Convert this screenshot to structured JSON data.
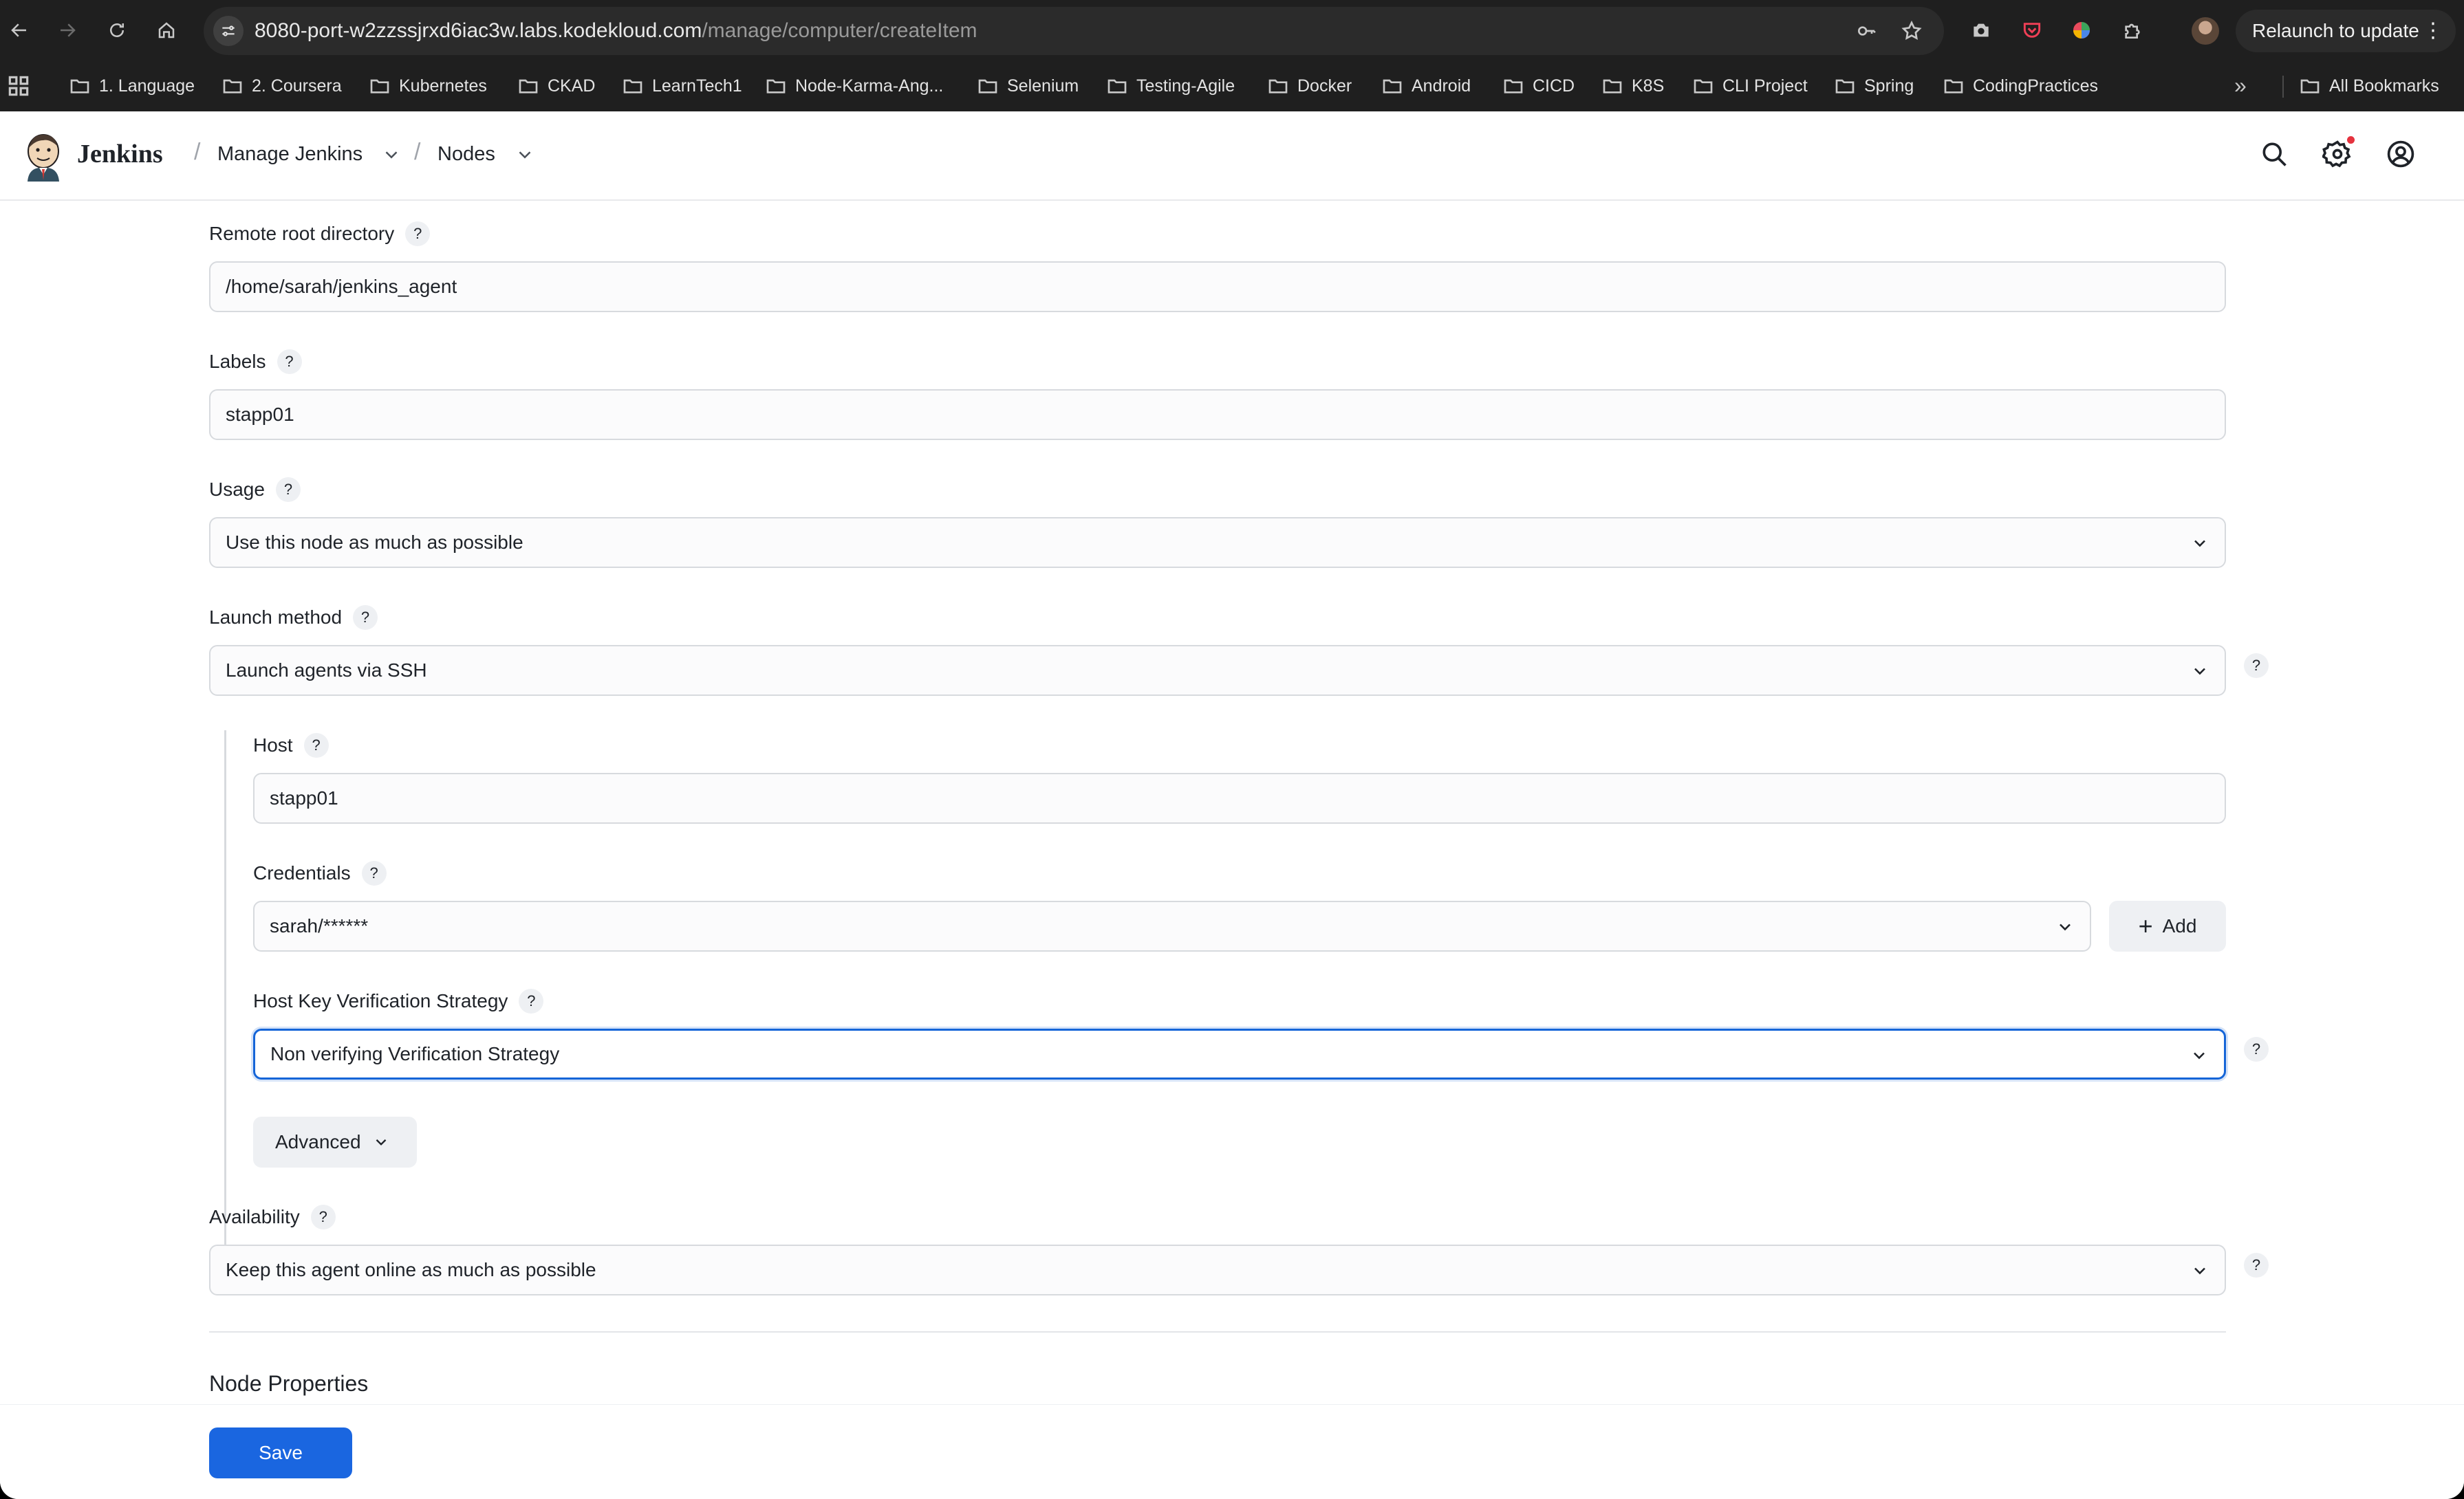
{
  "browser": {
    "url_host": "8080-port-w2zzssjrxd6iac3w.labs.kodekloud.com",
    "url_path": "/manage/computer/createItem",
    "relaunch_label": "Relaunch to update",
    "bookmarks": [
      {
        "label": "1. Language"
      },
      {
        "label": "2. Coursera"
      },
      {
        "label": "Kubernetes"
      },
      {
        "label": "CKAD"
      },
      {
        "label": "LearnTech1"
      },
      {
        "label": "Node-Karma-Ang..."
      },
      {
        "label": "Selenium"
      },
      {
        "label": "Testing-Agile"
      },
      {
        "label": "Docker"
      },
      {
        "label": "Android"
      },
      {
        "label": "CICD"
      },
      {
        "label": "K8S"
      },
      {
        "label": "CLI Project"
      },
      {
        "label": "Spring"
      },
      {
        "label": "CodingPractices"
      }
    ],
    "overflow_label": "»",
    "all_bookmarks_label": "All Bookmarks"
  },
  "header": {
    "brand": "Jenkins",
    "breadcrumbs": [
      {
        "label": "Manage Jenkins"
      },
      {
        "label": "Nodes"
      }
    ],
    "separator": "/"
  },
  "form": {
    "help_glyph": "?",
    "remote_root": {
      "label": "Remote root directory",
      "value": "/home/sarah/jenkins_agent"
    },
    "labels": {
      "label": "Labels",
      "value": "stapp01"
    },
    "usage": {
      "label": "Usage",
      "selected": "Use this node as much as possible"
    },
    "launch_method": {
      "label": "Launch method",
      "selected": "Launch agents via SSH"
    },
    "host": {
      "label": "Host",
      "value": "stapp01"
    },
    "credentials": {
      "label": "Credentials",
      "selected": "sarah/******",
      "add_label": "Add"
    },
    "host_key": {
      "label": "Host Key Verification Strategy",
      "selected": "Non verifying Verification Strategy"
    },
    "advanced_label": "Advanced",
    "availability": {
      "label": "Availability",
      "selected": "Keep this agent online as much as possible"
    },
    "node_properties_title": "Node Properties",
    "save_label": "Save"
  },
  "colors": {
    "primary": "#1a66e0",
    "focus_ring": "#1565d8",
    "notification_dot": "#e5323e"
  }
}
